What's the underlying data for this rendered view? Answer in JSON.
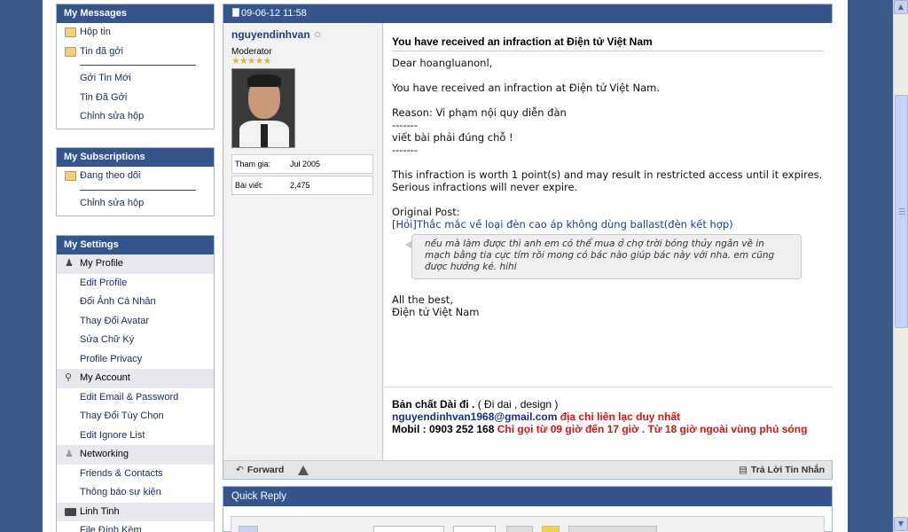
{
  "sidebar": {
    "messages": {
      "title": "My Messages",
      "items": [
        {
          "label": "Hộp tin",
          "icon": "folder-icon"
        },
        {
          "label": "Tin đã gởi",
          "icon": "folder-icon"
        },
        {
          "label": "Gởi Tin Mới"
        },
        {
          "label": "Tin Đã Gởi"
        },
        {
          "label": "Chỉnh sửa hộp"
        }
      ]
    },
    "subscriptions": {
      "title": "My Subscriptions",
      "items": [
        {
          "label": "Đang theo dõi",
          "icon": "folder-icon"
        },
        {
          "label": "Chỉnh sửa hộp"
        }
      ]
    },
    "settings": {
      "title": "My Settings",
      "groups": [
        {
          "label": "My Profile",
          "icon": "person-icon",
          "items": [
            "Edit Profile",
            "Đổi Ảnh Cá Nhân",
            "Thay Đổi Avatar",
            "Sửa Chữ Ký",
            "Profile Privacy"
          ]
        },
        {
          "label": "My Account",
          "icon": "key-icon",
          "items": [
            "Edit Email & Password",
            "Thay Đổi Tùy Chọn",
            "Edit Ignore List"
          ]
        },
        {
          "label": "Networking",
          "icon": "people-icon",
          "items": [
            "Friends & Contacts",
            "Thông báo sự kiện"
          ]
        },
        {
          "label": "Linh Tinh",
          "icon": "monitors-icon",
          "items": [
            "File Đính Kèm"
          ]
        }
      ]
    }
  },
  "post": {
    "date": "09-06-12 11:58",
    "username": "nguyendinhvan",
    "usertitle": "Moderator",
    "stars": "★★★★★",
    "join_label": "Tham gia:",
    "join_value": "Jul 2005",
    "posts_label": "Bài viết:",
    "posts_value": "2,475",
    "title": "You have received an infraction at Điện tử Việt Nam",
    "greeting": "Dear hoangluanonl,",
    "line1": "You have received an infraction at Điện tử Việt Nam.",
    "reason": "Reason: Vi phạm nội quy diễn đàn",
    "dash1": "-------",
    "reason_detail": "viết bài phải đúng chỗ !",
    "dash2": "-------",
    "points": "This infraction is worth 1 point(s) and may result in restricted access until it expires. Serious infractions will never expire.",
    "original_label": "Original Post:",
    "original_link": "[Hỏi]Thắc mắc về loại đèn cao áp không dùng ballast(đèn kết hợp)",
    "quote": "nếu mà làm được thì anh em có thể mua ở chợ trời bóng thủy ngân về in mạch bằng tia cực tím rồi mong có bác nào giúp bác này với nha. em cũng được hưởng ké. hihi",
    "closing": "All the best,",
    "signoff": "Điện tử Việt Nam",
    "signature": {
      "line1_bold": "Bản chất Dài đi .",
      "line1_rest": " ( Đi dai , design )",
      "email": "nguyendinhvan1968@gmail.com",
      "email_note": " địa chỉ liên lạc duy nhất",
      "mobile": "Mobil : 0903 252 168",
      "mobile_note": " Chỉ gọi từ 09 giờ đến 17 giờ . Từ 18 giờ ngoài vùng phủ sóng"
    },
    "forward_label": "Forward",
    "reply_label": "Trả Lời Tin Nhắn"
  },
  "quick_reply": {
    "title": "Quick Reply"
  },
  "colors": {
    "header_bg": "#35558f",
    "page_bg": "#3b5a8c",
    "link": "#213c8a",
    "signature_red": "#d71515"
  }
}
